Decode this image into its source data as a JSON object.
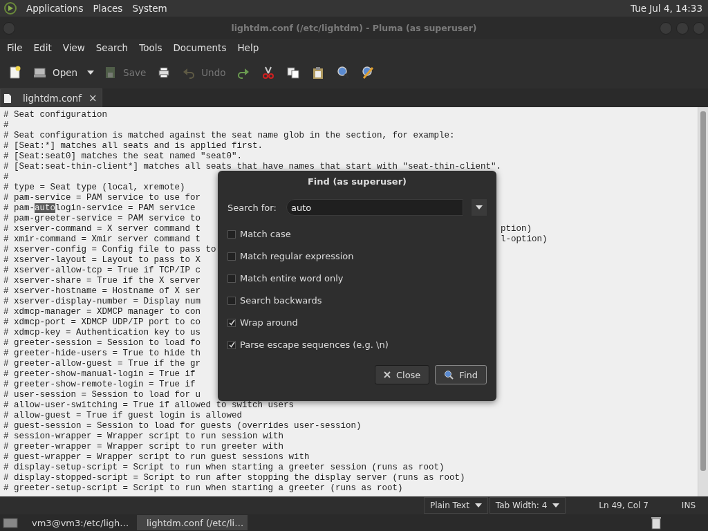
{
  "top_panel": {
    "menus": [
      "Applications",
      "Places",
      "System"
    ],
    "clock": "Tue Jul  4, 14:33"
  },
  "window": {
    "title": "lightdm.conf (/etc/lightdm) - Pluma (as superuser)"
  },
  "menubar": [
    "File",
    "Edit",
    "View",
    "Search",
    "Tools",
    "Documents",
    "Help"
  ],
  "toolbar": [
    {
      "disabled": false
    },
    {
      "label": "Open",
      "disabled": false
    },
    {
      "label": "Save",
      "disabled": true
    },
    {
      "disabled": false
    },
    {
      "label": "Undo",
      "disabled": true
    },
    {
      "disabled": false
    },
    {
      "disabled": false
    },
    {
      "disabled": false
    },
    {
      "disabled": false
    },
    {
      "disabled": false
    },
    {
      "disabled": false
    }
  ],
  "tabs": [
    {
      "label": "lightdm.conf",
      "close": "×",
      "selected": true
    }
  ],
  "editor": {
    "lines": [
      {
        "text": "# Seat configuration"
      },
      {
        "text": "#"
      },
      {
        "text": "# Seat configuration is matched against the seat name glob in the section, for example:"
      },
      {
        "text": "# [Seat:*] matches all seats and is applied first."
      },
      {
        "text": "# [Seat:seat0] matches the seat named \"seat0\"."
      },
      {
        "text": "# [Seat:seat-thin-client*] matches all seats that have names that start with \"seat-thin-client\"."
      },
      {
        "text": "#"
      },
      {
        "text": "# type = Seat type (local, xremote)"
      },
      {
        "text": "# pam-service = PAM service to use for"
      },
      {
        "before": "# pam-",
        "match": "auto",
        "after": "login-service = PAM service"
      },
      {
        "text": "# pam-greeter-service = PAM service to"
      },
      {
        "text": "# xserver-command = X server command t",
        "right": "ption)"
      },
      {
        "text": "# xmir-command = Xmir server command t",
        "right": "l-option)"
      },
      {
        "text": "# xserver-config = Config file to pass to"
      },
      {
        "text": "# xserver-layout = Layout to pass to X"
      },
      {
        "text": "# xserver-allow-tcp = True if TCP/IP c"
      },
      {
        "text": "# xserver-share = True if the X server"
      },
      {
        "text": "# xserver-hostname = Hostname of X ser"
      },
      {
        "text": "# xserver-display-number = Display num"
      },
      {
        "text": "# xdmcp-manager = XDMCP manager to con"
      },
      {
        "text": "# xdmcp-port = XDMCP UDP/IP port to co"
      },
      {
        "text": "# xdmcp-key = Authentication key to us"
      },
      {
        "text": "# greeter-session = Session to load fo"
      },
      {
        "text": "# greeter-hide-users = True to hide th"
      },
      {
        "text": "# greeter-allow-guest = True if the gr"
      },
      {
        "text": "# greeter-show-manual-login = True if"
      },
      {
        "text": "# greeter-show-remote-login = True if"
      },
      {
        "text": "# user-session = Session to load for u"
      },
      {
        "text": "# allow-user-switching = True if allowed to switch users"
      },
      {
        "text": "# allow-guest = True if guest login is allowed"
      },
      {
        "text": "# guest-session = Session to load for guests (overrides user-session)"
      },
      {
        "text": "# session-wrapper = Wrapper script to run session with"
      },
      {
        "text": "# greeter-wrapper = Wrapper script to run greeter with"
      },
      {
        "text": "# guest-wrapper = Wrapper script to run guest sessions with"
      },
      {
        "text": "# display-setup-script = Script to run when starting a greeter session (runs as root)"
      },
      {
        "text": "# display-stopped-script = Script to run after stopping the display server (runs as root)"
      },
      {
        "text": "# greeter-setup-script = Script to run when starting a greeter (runs as root)"
      }
    ]
  },
  "find_dialog": {
    "title": "Find (as superuser)",
    "search_label": "Search for:",
    "search_value": "auto",
    "options": [
      {
        "label": "Match case",
        "checked": false
      },
      {
        "label": "Match regular expression",
        "checked": false
      },
      {
        "label": "Match entire word only",
        "checked": false
      },
      {
        "label": "Search backwards",
        "checked": false
      },
      {
        "label": "Wrap around",
        "checked": true
      },
      {
        "label": "Parse escape sequences (e.g. \\n)",
        "checked": true
      }
    ],
    "buttons": [
      {
        "label": "Close",
        "selected": false
      },
      {
        "label": "Find",
        "selected": true
      }
    ]
  },
  "status_bar": {
    "language": "Plain Text",
    "tab_width": "Tab Width:  4",
    "position": "Ln 49, Col 7",
    "mode": "INS"
  },
  "taskbar": [
    {
      "label": "vm3@vm3:/etc/ligh…",
      "selected": false
    },
    {
      "label": "lightdm.conf (/etc/li…",
      "selected": true
    }
  ]
}
